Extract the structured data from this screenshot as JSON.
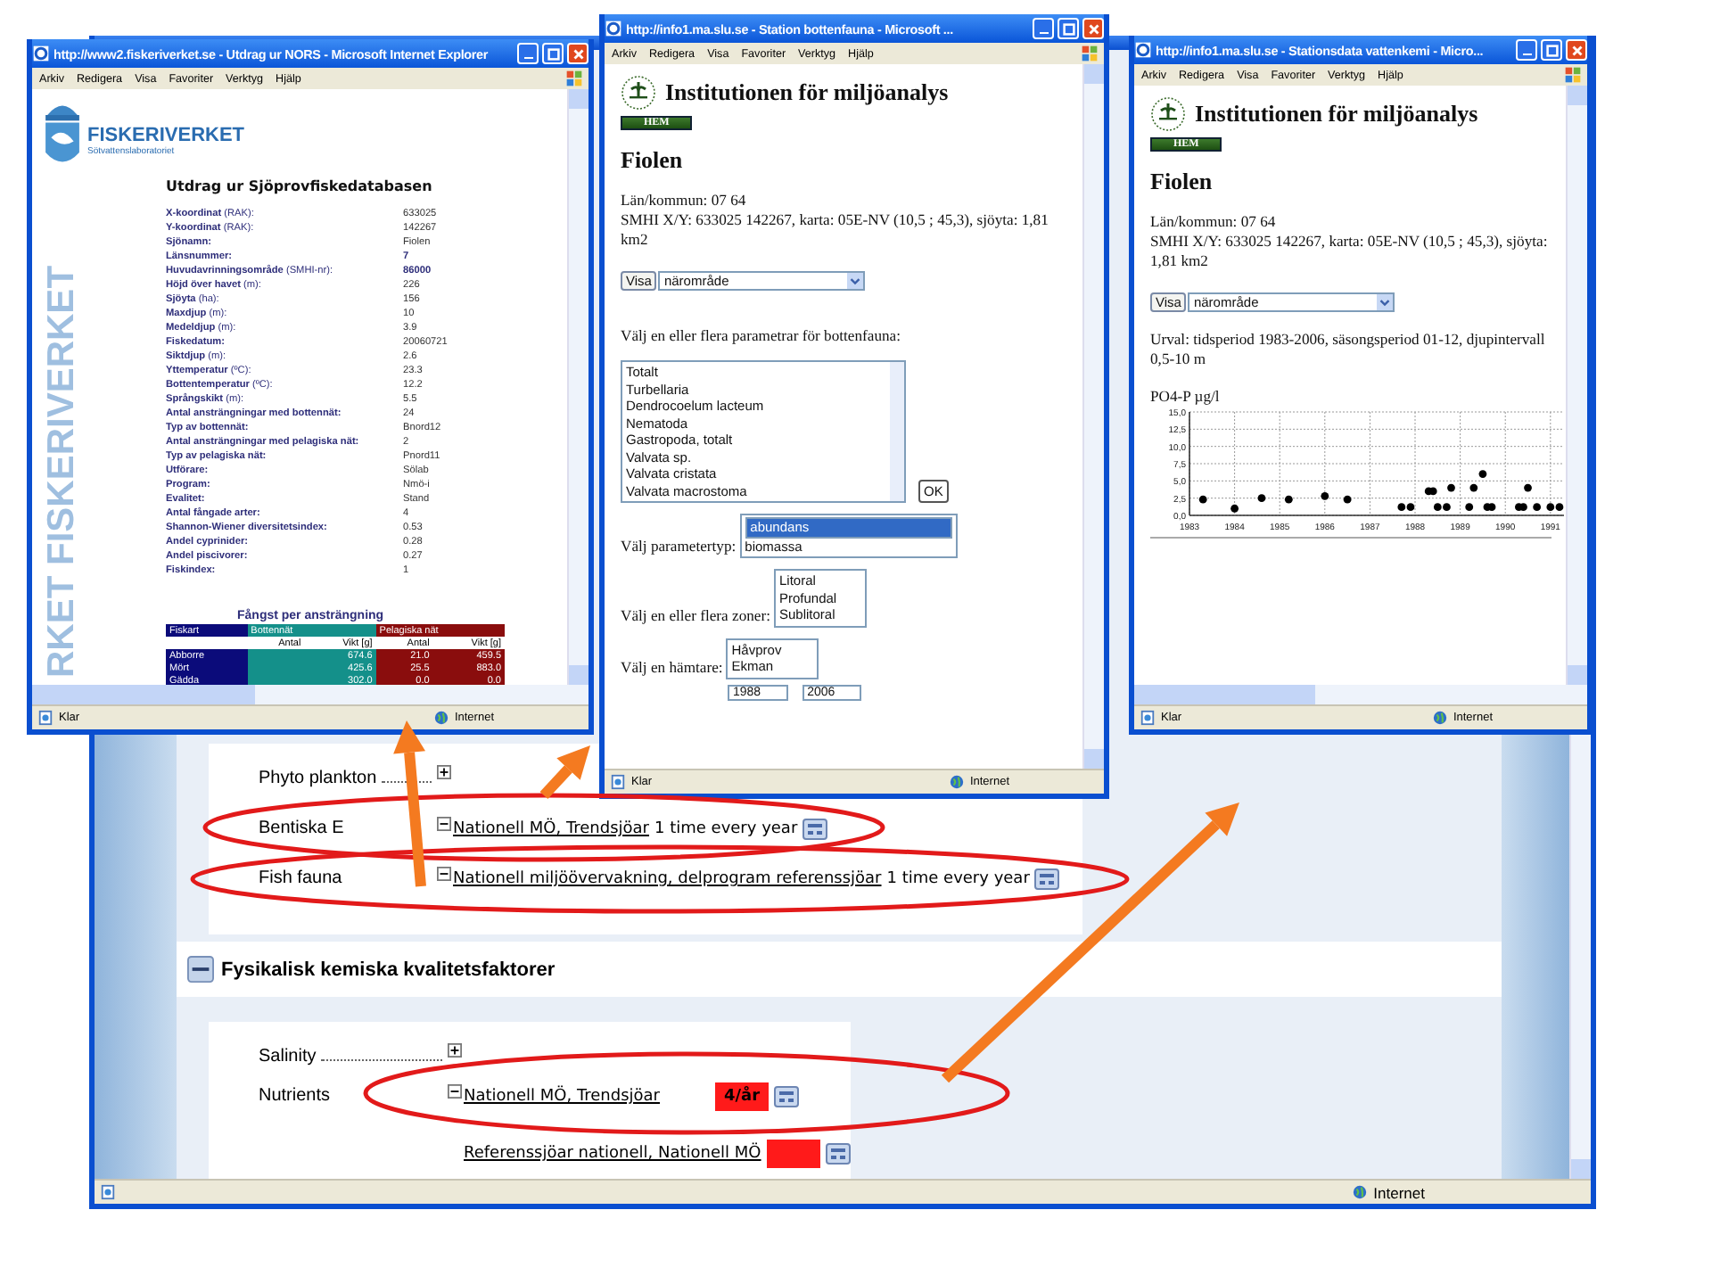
{
  "background_window": {
    "status_text": "Internet",
    "sections": [
      {
        "kind": "card",
        "rows": [
          {
            "label": "Phyto plankton",
            "expanded": false
          },
          {
            "label": "Bentiska E",
            "expanded": true,
            "entries": [
              {
                "link": "Nationell MÖ, Trendsjöar",
                "frequency": "1 time every year"
              }
            ]
          },
          {
            "label": "Fish fauna",
            "expanded": true,
            "entries": [
              {
                "link": "Nationell miljöövervakning, delprogram referenssjöar",
                "frequency": "1 time every year"
              }
            ]
          }
        ]
      },
      {
        "kind": "header",
        "title": "Fysikalisk kemiska kvalitetsfaktorer",
        "expanded": true
      },
      {
        "kind": "card",
        "rows": [
          {
            "label": "Salinity",
            "expanded": false
          },
          {
            "label": "Nutrients",
            "expanded": true,
            "entries": [
              {
                "link": "Nationell MÖ, Trendsjöar",
                "badge": "4/år",
                "highlight": true
              },
              {
                "link": "Referenssjöar nationell, Nationell MÖ",
                "highlight": true
              }
            ]
          }
        ]
      }
    ]
  },
  "left_window": {
    "title": "http://www2.fiskeriverket.se - Utdrag ur NORS - Microsoft Internet Explorer",
    "menu": [
      "Arkiv",
      "Redigera",
      "Visa",
      "Favoriter",
      "Verktyg",
      "Hjälp"
    ],
    "watermark": "RKET FISKERIVERKET",
    "logo_name": "FISKERIVERKET",
    "logo_subtitle": "Sötvattenslaboratoriet",
    "heading": "Utdrag ur Sjöprovfiskedatabasen",
    "facts": [
      {
        "label": "**X-koordinat** (RAK):",
        "value": "633025",
        "emphasis": false
      },
      {
        "label": "**Y-koordinat** (RAK):",
        "value": "142267",
        "emphasis": false
      },
      {
        "label": "**Sjönamn:**",
        "value": "Fiolen",
        "emphasis": false
      },
      {
        "label": "**Länsnummer:**",
        "value": "7",
        "emphasis": true
      },
      {
        "label": "**Huvudavrinningsområde** (SMHI-nr):",
        "value": "86000",
        "emphasis": true
      },
      {
        "label": "**Höjd över havet** (m):",
        "value": "226",
        "emphasis": false
      },
      {
        "label": "**Sjöyta** (ha):",
        "value": "156",
        "emphasis": false
      },
      {
        "label": "**Maxdjup** (m):",
        "value": "10",
        "emphasis": false
      },
      {
        "label": "**Medeldjup** (m):",
        "value": "3.9",
        "emphasis": false
      },
      {
        "label": "**Fiskedatum:**",
        "value": "20060721",
        "emphasis": false
      },
      {
        "label": "**Siktdjup** (m):",
        "value": "2.6",
        "emphasis": false
      },
      {
        "label": "**Yttemperatur** (ºC):",
        "value": "23.3",
        "emphasis": false
      },
      {
        "label": "**Bottentemperatur** (ºC):",
        "value": "12.2",
        "emphasis": false
      },
      {
        "label": "**Språngskikt** (m):",
        "value": "5.5",
        "emphasis": false
      },
      {
        "label": "**Antal ansträngningar med bottennät:**",
        "value": "24",
        "emphasis": false
      },
      {
        "label": "**Typ av bottennät:**",
        "value": "Bnord12",
        "emphasis": false
      },
      {
        "label": "**Antal ansträngningar med pelagiska nät:**",
        "value": "2",
        "emphasis": false
      },
      {
        "label": "**Typ av pelagiska nät:**",
        "value": "Pnord11",
        "emphasis": false
      },
      {
        "label": "**Utförare:**",
        "value": "Sölab",
        "emphasis": false
      },
      {
        "label": "**Program:**",
        "value": "Nmö-i",
        "emphasis": false
      },
      {
        "label": "**Evalitet:**",
        "value": "Stand",
        "emphasis": false
      },
      {
        "label": "**Antal fångade arter:**",
        "value": "4",
        "emphasis": false
      },
      {
        "label": "**Shannon-Wiener diversitetsindex:**",
        "value": "0.53",
        "emphasis": false
      },
      {
        "label": "**Andel cyprinider:**",
        "value": "0.28",
        "emphasis": false
      },
      {
        "label": "**Andel piscivorer:**",
        "value": "0.27",
        "emphasis": false
      },
      {
        "label": "**Fiskindex:**",
        "value": "1",
        "emphasis": false
      }
    ],
    "catch_table": {
      "title": "Fångst per ansträngning",
      "groups": [
        "Fiskart",
        "Bottennät",
        "Pelagiska nät"
      ],
      "subheaders": [
        "Antal",
        "Vikt [g]",
        "Antal",
        "Vikt [g]"
      ],
      "rows": [
        {
          "species": "Abborre",
          "values": [
            "674.6",
            "21.0",
            "459.5"
          ]
        },
        {
          "species": "Mört",
          "values": [
            "425.6",
            "25.5",
            "883.0"
          ]
        },
        {
          "species": "Gädda",
          "values": [
            "302.0",
            "0.0",
            "0.0"
          ]
        }
      ]
    },
    "status": [
      "Klar",
      "Internet"
    ]
  },
  "middle_window": {
    "title": "http://info1.ma.slu.se - Station bottenfauna - Microsoft ...",
    "menu": [
      "Arkiv",
      "Redigera",
      "Visa",
      "Favoriter",
      "Verktyg",
      "Hjälp"
    ],
    "org_name": "Institutionen för miljöanalys",
    "home_button": "HEM",
    "heading": "Fiolen",
    "info_lines": [
      "Län/kommun: 07 64",
      "SMHI X/Y: 633025 142267, karta: 05E-NV (10,5 ; 45,3), sjöyta: 1,81 km2"
    ],
    "view_button": "Visa",
    "area_select": "närområde",
    "parameter_prompt": "Välj en eller flera parametrar för bottenfauna:",
    "parameters": [
      "Totalt",
      "Turbellaria",
      "Dendrocoelum lacteum",
      "Nematoda",
      "Gastropoda, totalt",
      "Valvata sp.",
      "Valvata cristata",
      "Valvata macrostoma"
    ],
    "ok_button": "OK",
    "type_prompt": "Välj parametertyp:",
    "types": [
      {
        "label": "abundans",
        "selected": true
      },
      {
        "label": "biomassa",
        "selected": false
      }
    ],
    "zone_prompt": "Välj en eller flera zoner:",
    "zones": [
      "Litoral",
      "Profundal",
      "Sublitoral"
    ],
    "sampler_prompt": "Välj en hämtare:",
    "samplers": [
      "Håvprov",
      "Ekman"
    ],
    "period_from": "1988",
    "period_to": "2006",
    "status": [
      "Klar",
      "Internet"
    ]
  },
  "right_window": {
    "title": "http://info1.ma.slu.se - Stationsdata vattenkemi - Micro...",
    "menu": [
      "Arkiv",
      "Redigera",
      "Visa",
      "Favoriter",
      "Verktyg",
      "Hjälp"
    ],
    "org_name": "Institutionen för miljöanalys",
    "home_button": "HEM",
    "heading": "Fiolen",
    "info_lines": [
      "Län/kommun: 07 64",
      "SMHI X/Y: 633025 142267, karta: 05E-NV (10,5 ; 45,3), sjöyta: 1,81 km2"
    ],
    "view_button": "Visa",
    "area_select": "närområde",
    "selection_text": "Urval: tidsperiod 1983-2006, säsongsperiod 01-12, djupintervall 0,5-10 m",
    "chart_data": {
      "type": "scatter",
      "title": "PO4-P µg/l",
      "x": [
        1983.3,
        1984.0,
        1984.6,
        1985.2,
        1986.0,
        1986.5,
        1987.7,
        1987.9,
        1988.3,
        1988.4,
        1988.5,
        1988.7,
        1988.8,
        1989.2,
        1989.3,
        1989.5,
        1989.6,
        1989.7,
        1990.3,
        1990.4,
        1990.5,
        1990.7,
        1991.0,
        1991.2
      ],
      "values": [
        2.3,
        1.0,
        2.5,
        2.3,
        2.8,
        2.3,
        1.2,
        1.2,
        3.5,
        3.5,
        1.2,
        1.2,
        4.0,
        1.2,
        4.0,
        6.0,
        1.2,
        1.2,
        1.2,
        1.2,
        4.0,
        1.2,
        1.2,
        1.2
      ],
      "xlim": [
        1983,
        1991.3
      ],
      "ylim": [
        0,
        15
      ],
      "grid": true,
      "xticks": [
        {
          "value": 1983,
          "label": "1983"
        },
        {
          "value": 1984,
          "label": "1984"
        },
        {
          "value": 1985,
          "label": "1985"
        },
        {
          "value": 1986,
          "label": "1986"
        },
        {
          "value": 1987,
          "label": "1987"
        },
        {
          "value": 1988,
          "label": "1988"
        },
        {
          "value": 1989,
          "label": "1989"
        },
        {
          "value": 1990,
          "label": "1990"
        },
        {
          "value": 1991,
          "label": "1991"
        }
      ],
      "yticks": [
        {
          "value": 0,
          "label": "0,0"
        },
        {
          "value": 2.5,
          "label": "2,5"
        },
        {
          "value": 5,
          "label": "5,0"
        },
        {
          "value": 7.5,
          "label": "7,5"
        },
        {
          "value": 10,
          "label": "10,0"
        },
        {
          "value": 12.5,
          "label": "12,5"
        },
        {
          "value": 15,
          "label": "15,0"
        }
      ]
    },
    "status": [
      "Klar",
      "Internet"
    ]
  }
}
